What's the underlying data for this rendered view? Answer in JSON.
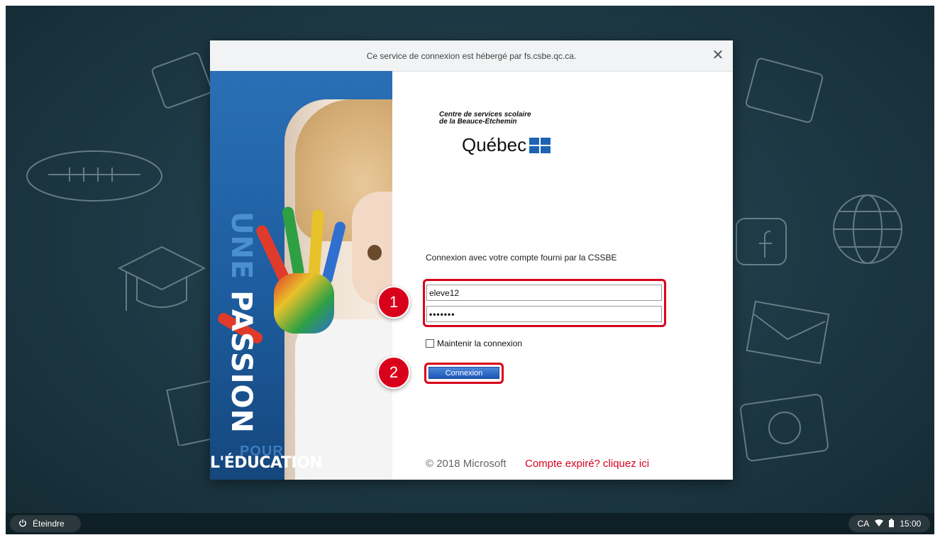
{
  "dialog": {
    "header_text": "Ce service de connexion est hébergé par fs.csbe.qc.ca.",
    "close_glyph": "✕"
  },
  "promo": {
    "line1_une": "UNE",
    "line1_passion": "PASSION",
    "pour": "POUR",
    "education": "L'ÉDUCATION"
  },
  "org": {
    "name_lines": "Centre de services scolaire de la Beauce-Etchemin",
    "quebec": "Québec"
  },
  "login": {
    "caption": "Connexion avec votre compte fourni par la CSSBE",
    "username_value": "eleve12",
    "password_value": "•••••••",
    "remember_label": "Maintenir la connexion",
    "submit_label": "Connexion"
  },
  "annotations": {
    "step1": "1",
    "step2": "2",
    "highlight_color": "#d9001b"
  },
  "footer": {
    "copyright": "© 2018 Microsoft",
    "expired_link": "Compte expiré? cliquez ici"
  },
  "shelf": {
    "power_label": "Éteindre",
    "locale": "CA",
    "time": "15:00",
    "icons": [
      "power-icon",
      "wifi-icon",
      "battery-icon"
    ]
  }
}
